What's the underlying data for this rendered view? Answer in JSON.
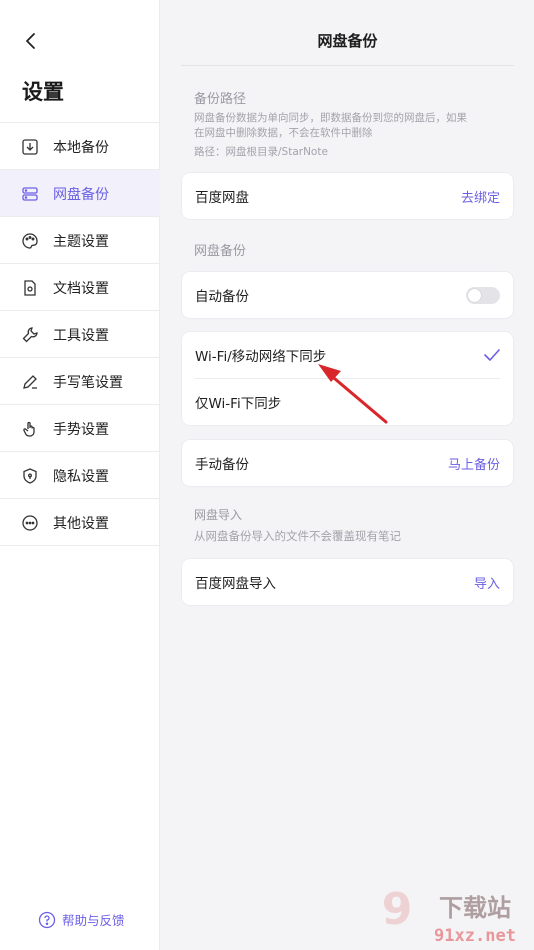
{
  "sidebar": {
    "title": "设置",
    "items": [
      {
        "label": "本地备份",
        "icon": "local-backup-icon"
      },
      {
        "label": "网盘备份",
        "icon": "cloud-drive-icon",
        "active": true
      },
      {
        "label": "主题设置",
        "icon": "palette-icon"
      },
      {
        "label": "文档设置",
        "icon": "document-settings-icon"
      },
      {
        "label": "工具设置",
        "icon": "wrench-icon"
      },
      {
        "label": "手写笔设置",
        "icon": "pen-icon"
      },
      {
        "label": "手势设置",
        "icon": "hand-gesture-icon"
      },
      {
        "label": "隐私设置",
        "icon": "shield-icon"
      },
      {
        "label": "其他设置",
        "icon": "more-icon"
      }
    ],
    "help_label": "帮助与反馈"
  },
  "main": {
    "title": "网盘备份",
    "path_section": {
      "title": "备份路径",
      "desc_line1": "网盘备份数据为单向同步，即数据备份到您的网盘后，如果",
      "desc_line2": "在网盘中删除数据，不会在软件中删除",
      "path": "路径：网盘根目录/StarNote"
    },
    "baidu": {
      "label": "百度网盘",
      "action": "去绑定"
    },
    "backup_section": {
      "title": "网盘备份"
    },
    "auto_backup": {
      "label": "自动备份",
      "enabled": false
    },
    "sync_options": [
      {
        "label": "Wi-Fi/移动网络下同步",
        "selected": true
      },
      {
        "label": "仅Wi-Fi下同步",
        "selected": false
      }
    ],
    "manual_backup": {
      "label": "手动备份",
      "action": "马上备份"
    },
    "import_section": {
      "title": "网盘导入",
      "desc": "从网盘备份导入的文件不会覆盖现有笔记"
    },
    "baidu_import": {
      "label": "百度网盘导入",
      "action": "导入"
    }
  },
  "watermark": {
    "text1": "下载站",
    "text2": "91xz.net"
  },
  "colors": {
    "accent": "#6b5fe6",
    "arrow": "#d9262b"
  }
}
